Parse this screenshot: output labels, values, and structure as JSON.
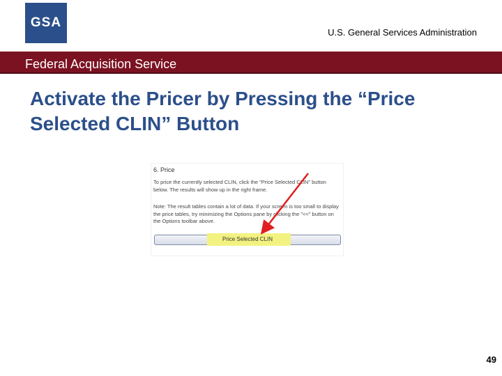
{
  "header": {
    "logo_text": "GSA",
    "agency_name": "U.S. General Services Administration",
    "banner_text": "Federal Acquisition Service",
    "banner_color": "#7b1221",
    "logo_color": "#2b4f8a"
  },
  "slide": {
    "title": "Activate the Pricer by Pressing the “Price Selected CLIN” Button",
    "page_number": "49"
  },
  "screenshot": {
    "heading": "6. Price",
    "paragraph_1": "To price the currently selected CLIN, click the \"Price Selected CLIN\" button below. The results will show up in the right frame.",
    "paragraph_2": "Note: The result tables contain a lot of data. If your screen is too small to display the price tables, try minimizing the Options pane by clicking the \"<<\" button on the Options toolbar above.",
    "button_label": "Price Selected CLIN",
    "highlight_color": "#f2f281",
    "arrow_color": "#e02020",
    "arrow_icon": "red-pointer-arrow"
  }
}
